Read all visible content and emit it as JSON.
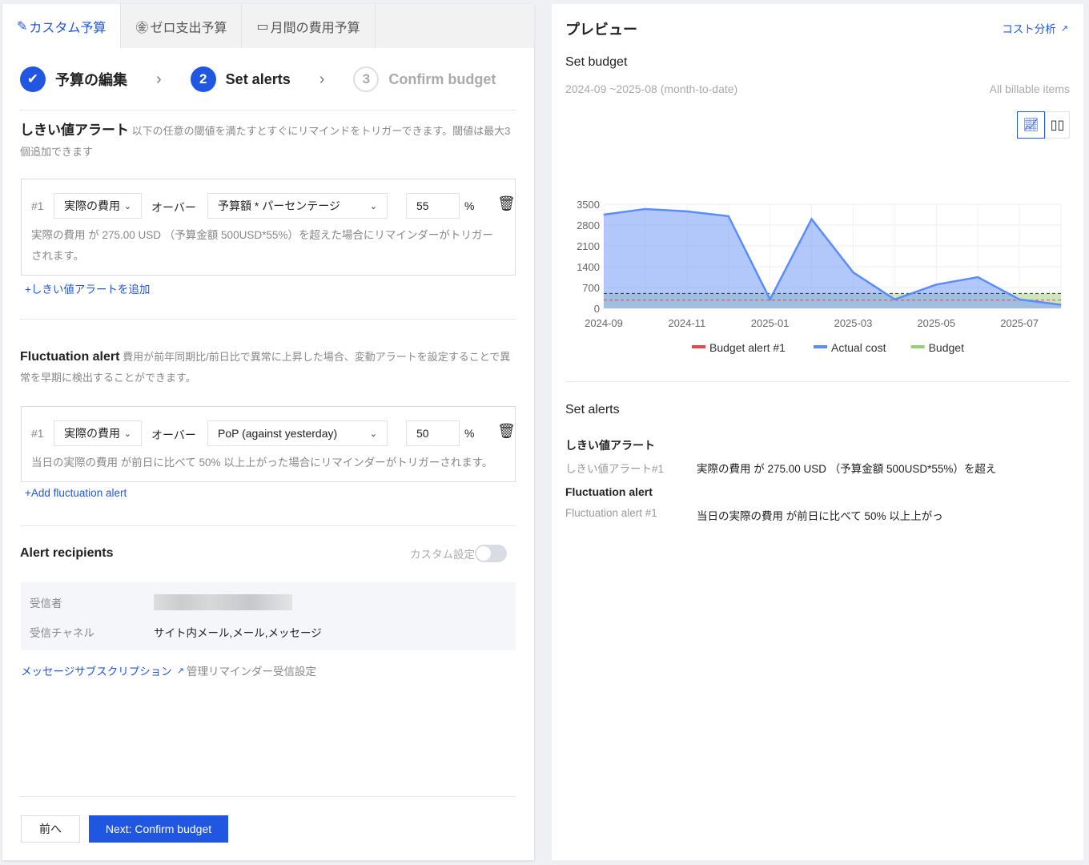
{
  "tabs": [
    {
      "label": "カスタム予算",
      "icon": "pencil-icon"
    },
    {
      "label": "ゼロ支出予算",
      "icon": "yen-circle-icon"
    },
    {
      "label": "月間の費用予算",
      "icon": "calendar-icon"
    }
  ],
  "steps": [
    {
      "label": "予算の編集",
      "state": "done"
    },
    {
      "num": "2",
      "label": "Set alerts",
      "state": "active"
    },
    {
      "num": "3",
      "label": "Confirm budget",
      "state": "pending"
    }
  ],
  "threshold": {
    "title": "しきい値アラート",
    "desc": "以下の任意の閾値を満たすとすぐにリマインドをトリガーできます。閾値は最大3個追加できます",
    "row": {
      "index": "#1",
      "metric": "実際の費用",
      "over": "オーバー",
      "type": "予算額 * パーセンテージ",
      "value": "55",
      "unit": "%"
    },
    "hint": "実際の費用 が 275.00 USD （予算金額 500USD*55%）を超えた場合にリマインダーがトリガーされます。",
    "add": "+しきい値アラートを追加"
  },
  "fluctuation": {
    "title": "Fluctuation alert",
    "desc": "費用が前年同期比/前日比で異常に上昇した場合、変動アラートを設定することで異常を早期に検出することができます。",
    "row": {
      "index": "#1",
      "metric": "実際の費用",
      "over": "オーバー",
      "type": "PoP (against yesterday)",
      "value": "50",
      "unit": "%"
    },
    "hint": "当日の実際の費用 が前日に比べて 50% 以上上がった場合にリマインダーがトリガーされます。",
    "add": "+Add fluctuation alert"
  },
  "recipients": {
    "title": "Alert recipients",
    "toggle_label": "カスタム設定",
    "toggle_on": false,
    "recipient_label": "受信者",
    "channel_label": "受信チャネル",
    "channel_value": "サイト内メール,メール,メッセージ",
    "sub_link": "メッセージサブスクリプション",
    "manage_link": "管理リマインダー受信設定"
  },
  "footer": {
    "prev": "前へ",
    "next": "Next: Confirm budget"
  },
  "preview": {
    "title": "プレビュー",
    "cost_link": "コスト分析",
    "subtitle": "Set budget",
    "range": "2024-09 ~2025-08 (month-to-date)",
    "scope": "All billable items",
    "alerts_title": "Set alerts",
    "threshold_title": "しきい値アラート",
    "threshold_label": "しきい値アラート#1",
    "threshold_value": "実際の費用 が 275.00 USD （予算金額 500USD*55%）を超え",
    "fluct_title": "Fluctuation alert",
    "fluct_label": "Fluctuation alert #1",
    "fluct_value": "当日の実際の費用 が前日に比べて 50% 以上上がっ"
  },
  "chart_data": {
    "type": "area",
    "x": [
      "2024-09",
      "2024-10",
      "2024-11",
      "2024-12",
      "2025-01",
      "2025-02",
      "2025-03",
      "2025-04",
      "2025-05",
      "2025-06",
      "2025-07",
      "2025-08"
    ],
    "xticks": [
      "2024-09",
      "2024-11",
      "2025-01",
      "2025-03",
      "2025-05",
      "2025-07"
    ],
    "yticks": [
      "0",
      "700",
      "1400",
      "2100",
      "2800",
      "3500"
    ],
    "ylim": [
      0,
      3500
    ],
    "series": [
      {
        "name": "Budget alert #1",
        "color": "#e04848",
        "values": [
          275,
          275,
          275,
          275,
          275,
          275,
          275,
          275,
          275,
          275,
          275,
          275
        ]
      },
      {
        "name": "Actual cost",
        "color": "#5b8cff",
        "values": [
          3150,
          3340,
          3260,
          3100,
          300,
          3000,
          1210,
          300,
          800,
          1050,
          300,
          120
        ]
      },
      {
        "name": "Budget",
        "color": "#95d075",
        "values": [
          500,
          500,
          500,
          500,
          500,
          500,
          500,
          500,
          500,
          500,
          500,
          500
        ]
      }
    ],
    "legend": "bottom"
  }
}
